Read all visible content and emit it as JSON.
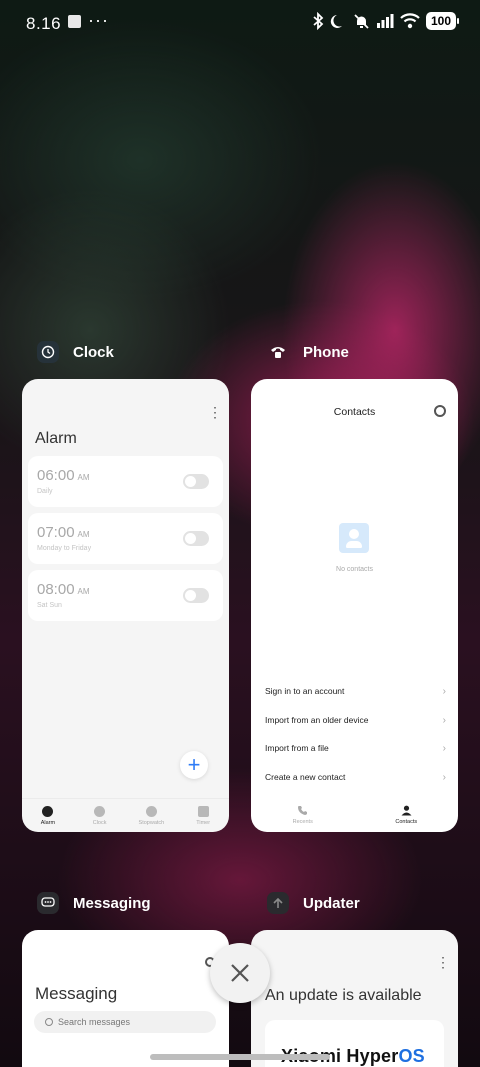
{
  "status_bar": {
    "time": "8.16",
    "more": "···",
    "battery": "100"
  },
  "colors": {
    "accent_blue": "#2f7cf6",
    "brand_blue": "#1e6fe0",
    "card_bg": "#f5f5f5"
  },
  "apps": {
    "clock": {
      "label": "Clock",
      "icon": "clock-icon",
      "screen_title": "Alarm",
      "alarms": [
        {
          "time": "06:00",
          "ampm": "AM",
          "repeat": "Daily"
        },
        {
          "time": "07:00",
          "ampm": "AM",
          "repeat": "Monday to Friday"
        },
        {
          "time": "08:00",
          "ampm": "AM",
          "repeat": "Sat Sun"
        }
      ],
      "add_label": "+",
      "nav": [
        "Alarm",
        "Clock",
        "Stopwatch",
        "Timer"
      ]
    },
    "phone": {
      "label": "Phone",
      "icon": "phone-icon",
      "screen_title": "Contacts",
      "empty_text": "No contacts",
      "actions": [
        "Sign in to an account",
        "Import from an older device",
        "Import from a file",
        "Create a new contact"
      ],
      "nav": [
        "Recents",
        "Contacts"
      ]
    },
    "messaging": {
      "label": "Messaging",
      "icon": "message-icon",
      "screen_title": "Messaging",
      "search_placeholder": "Search messages"
    },
    "updater": {
      "label": "Updater",
      "icon": "arrow-up-icon",
      "screen_title": "An update is available",
      "brand_prefix": "Xiaomi Hyper",
      "brand_suffix": "OS"
    }
  }
}
